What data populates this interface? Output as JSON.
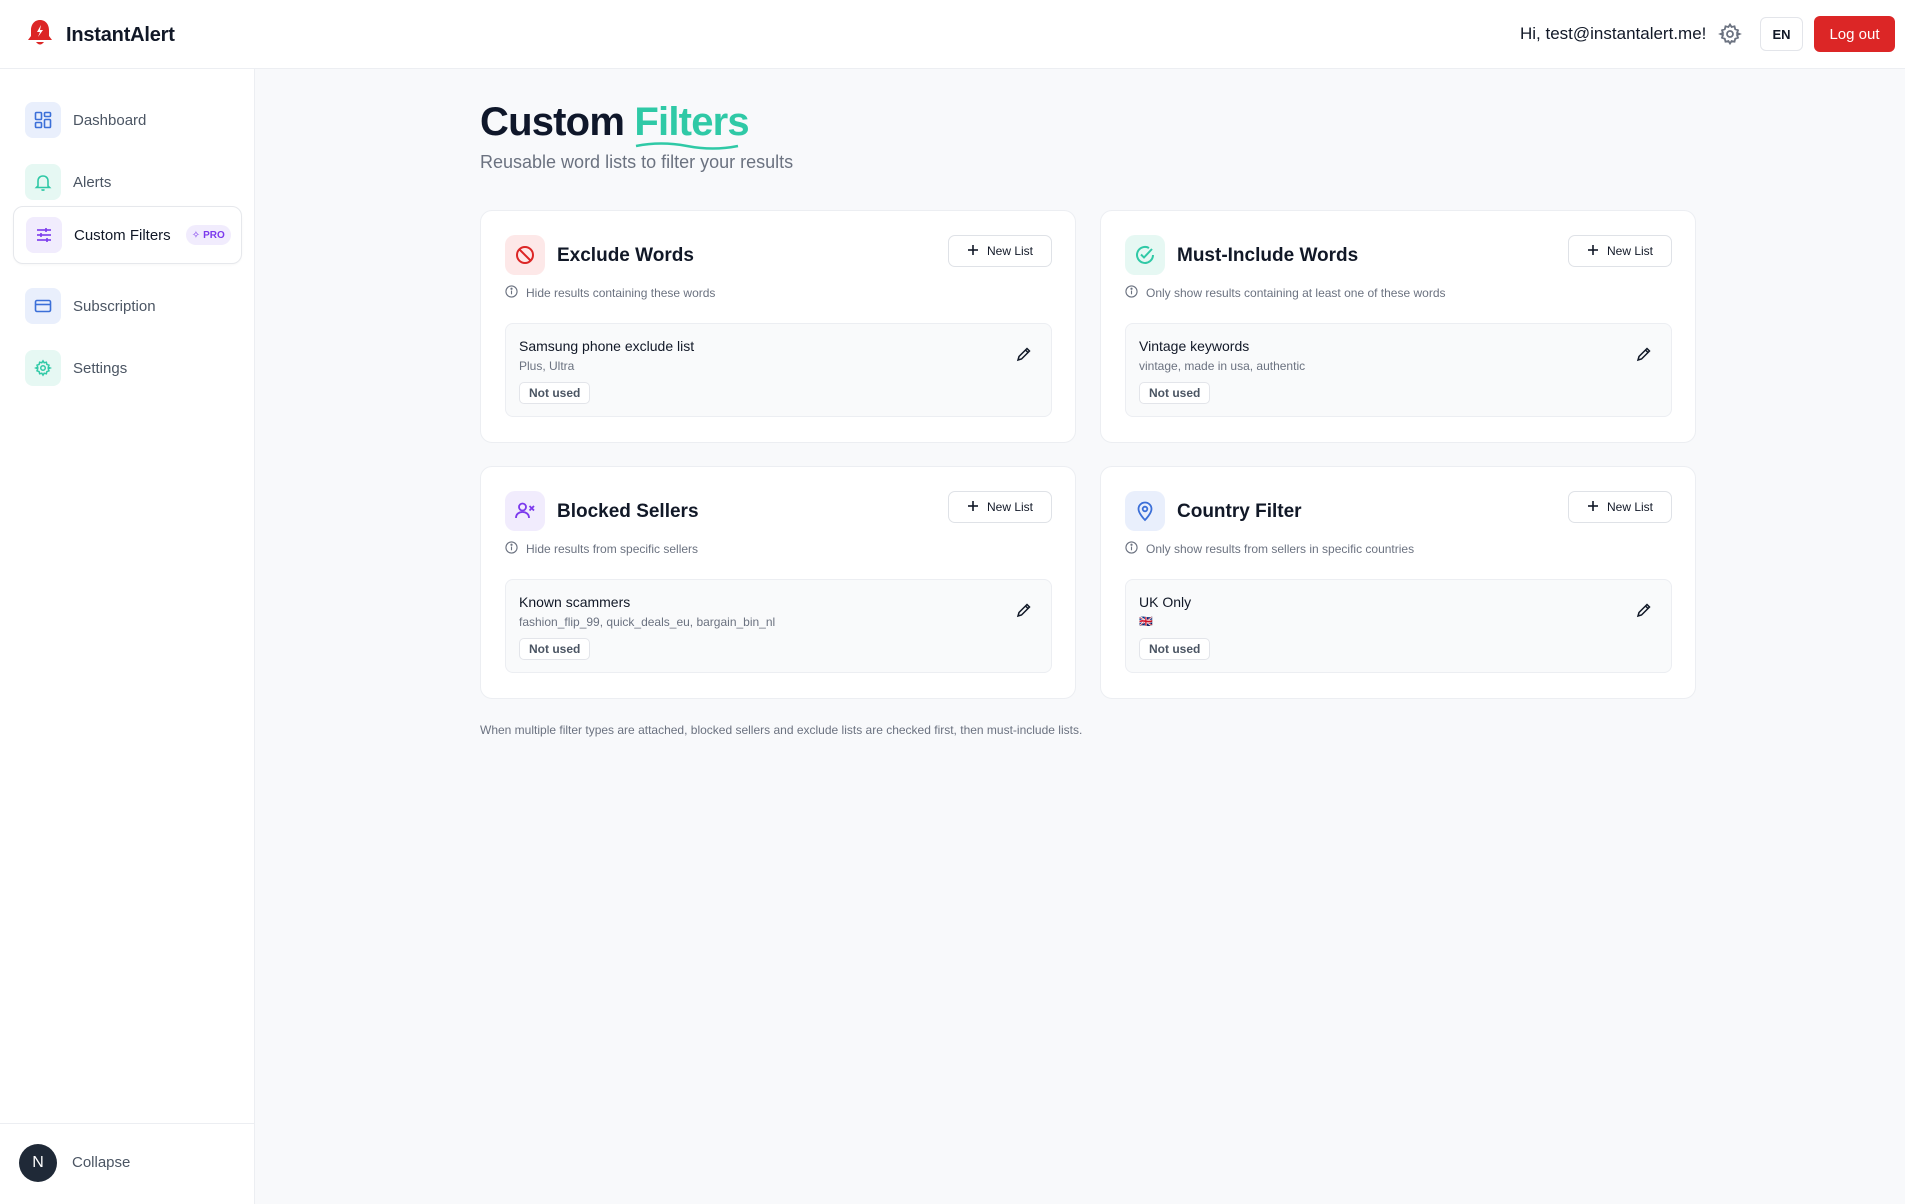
{
  "header": {
    "brand": "InstantAlert",
    "greeting": "Hi, test@instantalert.me!",
    "language": "EN",
    "logout_label": "Log out"
  },
  "sidebar": {
    "items": [
      {
        "label": "Dashboard",
        "icon": "dashboard-icon"
      },
      {
        "label": "Alerts",
        "icon": "bell-icon"
      },
      {
        "label": "Custom Filters",
        "icon": "sliders-icon",
        "badge": "PRO",
        "active": true
      },
      {
        "label": "Subscription",
        "icon": "credit-card-icon"
      },
      {
        "label": "Settings",
        "icon": "gear-icon"
      }
    ],
    "avatar_initial": "N",
    "collapse_label": "Collapse"
  },
  "page": {
    "title_part1": "Custom",
    "title_part2": "Filters",
    "subtitle": "Reusable word lists to filter your results"
  },
  "cards": [
    {
      "title": "Exclude Words",
      "description": "Hide results containing these words",
      "new_label": "New List",
      "icon": "ban-icon",
      "list": {
        "name": "Samsung phone exclude list",
        "words": "Plus, Ultra",
        "status": "Not used"
      }
    },
    {
      "title": "Must-Include Words",
      "description": "Only show results containing at least one of these words",
      "new_label": "New List",
      "icon": "check-circle-icon",
      "list": {
        "name": "Vintage keywords",
        "words": "vintage, made in usa, authentic",
        "status": "Not used"
      }
    },
    {
      "title": "Blocked Sellers",
      "description": "Hide results from specific sellers",
      "new_label": "New List",
      "icon": "user-x-icon",
      "list": {
        "name": "Known scammers",
        "words": "fashion_flip_99, quick_deals_eu, bargain_bin_nl",
        "status": "Not used"
      }
    },
    {
      "title": "Country Filter",
      "description": "Only show results from sellers in specific countries",
      "new_label": "New List",
      "icon": "map-pin-icon",
      "list": {
        "name": "UK Only",
        "words": "🇬🇧",
        "status": "Not used"
      }
    }
  ],
  "footnote": "When multiple filter types are attached, blocked sellers and exclude lists are checked first, then must-include lists.",
  "colors": {
    "accent": "#2fc9a6",
    "danger": "#dc2626",
    "pro": "#7c3aed"
  }
}
